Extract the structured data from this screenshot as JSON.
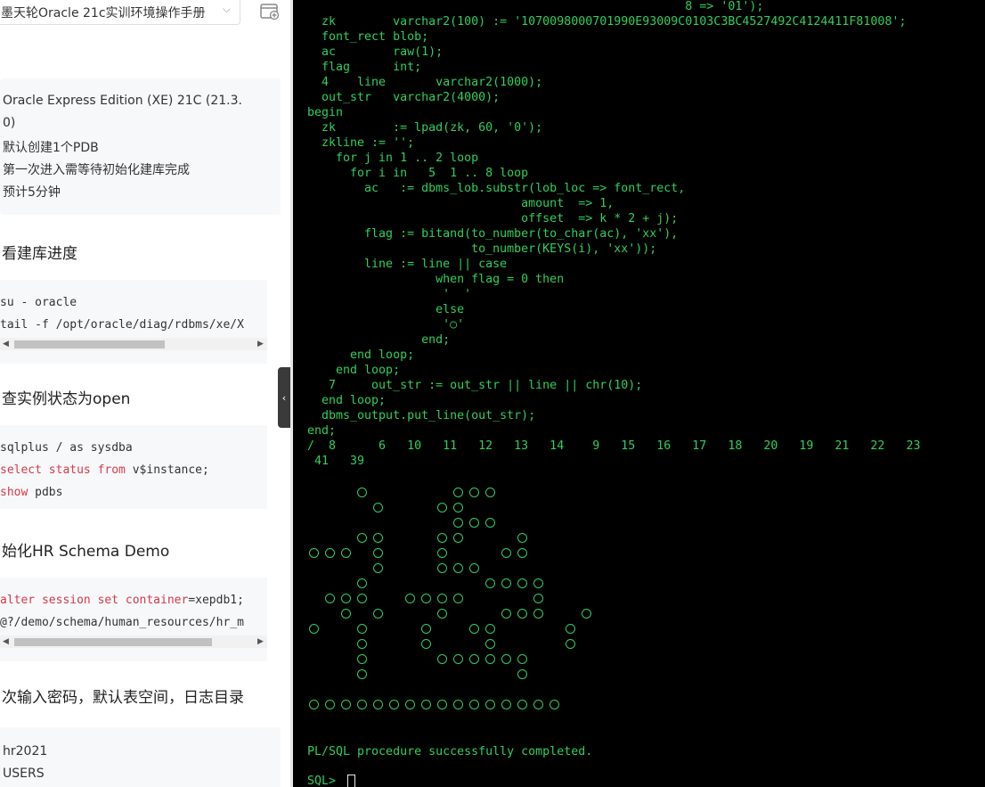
{
  "sidebar": {
    "manual_select": "墨天轮Oracle 21c实训环境操作手册",
    "card1": [
      "Oracle Express Edition (XE) 21C (21.3.",
      "0)",
      "默认创建1个PDB",
      "第一次进入需等待初始化建库完成",
      "预计5分钟"
    ],
    "heading_progress": "看建库进度",
    "code1": [
      "su - oracle",
      "tail -f /opt/oracle/diag/rdbms/xe/X"
    ],
    "heading_status": "查实例状态为open",
    "code2": {
      "l1": "sqlplus / as sysdba",
      "l2_kw": "select status from",
      "l2_rest": " v$instance;",
      "l3_kw": "show",
      "l3_rest": " pdbs"
    },
    "heading_hr": "始化HR Schema Demo",
    "code3": {
      "l1_kw": "alter session set container",
      "l1_rest": "=xepdb1;",
      "l2": "@?/demo/schema/human_resources/hr_m"
    },
    "heading_pwd": "次输入密码，默认表空间，日志目录",
    "card2": [
      "hr2021",
      "USERS"
    ]
  },
  "terminal": {
    "lines": [
      "                                                     8 => '01');",
      "  zk        varchar2(100) := '1070098000701990E93009C0103C3BC4527492C4124411F81008';",
      "  font_rect blob;",
      "  ac        raw(1);",
      "  flag      int;",
      "  4    line       varchar2(1000);",
      "  out_str   varchar2(4000);",
      "begin",
      "  zk        := lpad(zk, 60, '0');",
      "  zkline := '';",
      "    for j in 1 .. 2 loop",
      "      for i in   5  1 .. 8 loop",
      "        ac   := dbms_lob.substr(lob_loc => font_rect,",
      "                              amount  => 1,",
      "                              offset  => k * 2 + j);",
      "        flag := bitand(to_number(to_char(ac), 'xx'),",
      "                       to_number(KEYS(i), 'xx'));",
      "        line := line || case",
      "                  when flag = 0 then",
      "                   '  '",
      "                  else",
      "                   '○'",
      "                end;",
      "      end loop;",
      "    end loop;",
      "   7     out_str := out_str || line || chr(10);",
      "  end loop;",
      "  dbms_output.put_line(out_str);",
      "end;",
      "/  8      6   10   11   12   13   14    9   15   16   17   18   20   19   21   22   23",
      " 41   39"
    ],
    "glyph_rows": [
      "   O     OOO",
      "    O   OO",
      "         OOO",
      "   OO   OO   O",
      "OOO O   O   OO",
      "    O   OOO",
      "   O       OOOO",
      " OOO  OOOO    O",
      "  O O   O   OOO  O",
      "O  O   O  OO    O",
      "   O   O   O    O",
      "   O    OOOOOO",
      "   O         O",
      "",
      "OOOOOOOOOOOOOOOO"
    ],
    "success_message": "PL/SQL procedure successfully completed.",
    "prompt": "SQL> "
  },
  "colors": {
    "terminal_bg": "#000000",
    "terminal_fg": "#2fcf5c",
    "keyword": "#d73a49"
  }
}
